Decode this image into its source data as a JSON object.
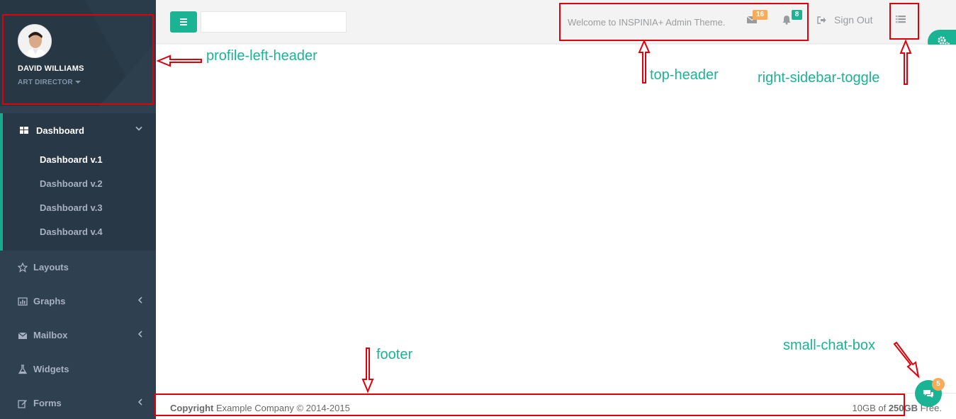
{
  "sidebar": {
    "profile": {
      "name": "DAVID WILLIAMS",
      "role": "ART DIRECTOR"
    },
    "active_section": {
      "label": "Dashboard",
      "icon": "th-large-icon",
      "items": [
        {
          "label": "Dashboard v.1"
        },
        {
          "label": "Dashboard v.2"
        },
        {
          "label": "Dashboard v.3"
        },
        {
          "label": "Dashboard v.4"
        }
      ]
    },
    "items": [
      {
        "label": "Layouts",
        "icon": "star-icon"
      },
      {
        "label": "Graphs",
        "icon": "bar-chart-icon"
      },
      {
        "label": "Mailbox",
        "icon": "envelope-icon"
      },
      {
        "label": "Widgets",
        "icon": "flask-icon"
      },
      {
        "label": "Forms",
        "icon": "edit-icon"
      }
    ]
  },
  "header": {
    "welcome": "Welcome to INSPINIA+ Admin Theme.",
    "messages_count": "16",
    "alerts_count": "8",
    "sign_out": "Sign Out"
  },
  "footer": {
    "copyright_bold": "Copyright",
    "copyright_text": "Example Company © 2014-2015",
    "storage_prefix": "10GB of",
    "storage_bold": "250GB",
    "storage_suffix": "Free."
  },
  "chat": {
    "count": "5"
  },
  "annotations": {
    "profile": "profile-left-header",
    "top_header": "top-header",
    "right_toggle": "right-sidebar-toggle",
    "footer": "footer",
    "chat": "small-chat-box"
  },
  "colors": {
    "accent": "#1ab394",
    "sidebar": "#2f4050",
    "badge_warning": "#f8ac59",
    "annotation": "#e0000a"
  }
}
